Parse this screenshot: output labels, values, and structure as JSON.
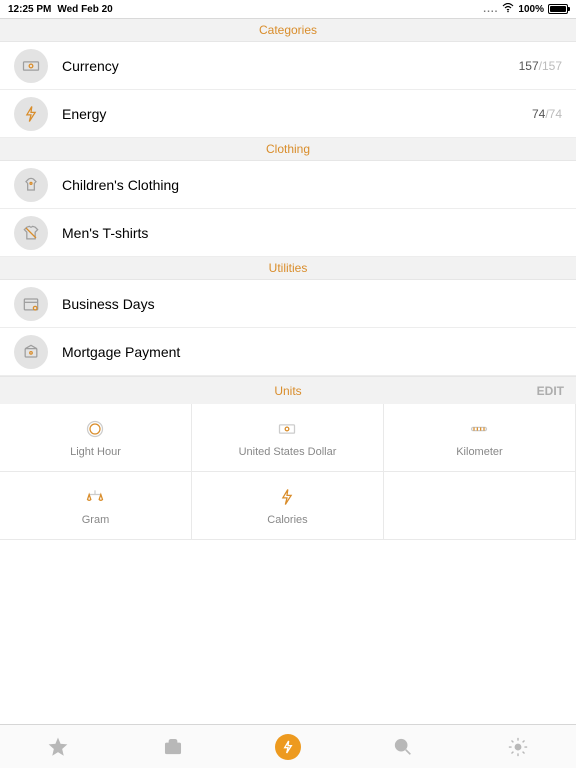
{
  "status": {
    "time": "12:25 PM",
    "date": "Wed Feb 20",
    "battery": "100%"
  },
  "sections": [
    {
      "title": "Categories",
      "rows": [
        {
          "label": "Currency",
          "count": {
            "have": "157",
            "of": "/157"
          },
          "icon": "currency-icon"
        },
        {
          "label": "Energy",
          "count": {
            "have": "74",
            "of": "/74"
          },
          "icon": "energy-icon"
        }
      ]
    },
    {
      "title": "Clothing",
      "rows": [
        {
          "label": "Children's Clothing",
          "icon": "children-clothing-icon"
        },
        {
          "label": "Men's T-shirts",
          "icon": "mens-tshirt-icon"
        }
      ]
    },
    {
      "title": "Utilities",
      "rows": [
        {
          "label": "Business Days",
          "icon": "business-days-icon"
        },
        {
          "label": "Mortgage Payment",
          "icon": "mortgage-icon"
        }
      ]
    }
  ],
  "units": {
    "title": "Units",
    "edit": "EDIT",
    "cells": [
      {
        "label": "Light Hour",
        "icon": "light-hour-icon"
      },
      {
        "label": "United States Dollar",
        "icon": "dollar-icon"
      },
      {
        "label": "Kilometer",
        "icon": "kilometer-icon"
      },
      {
        "label": "Gram",
        "icon": "gram-icon"
      },
      {
        "label": "Calories",
        "icon": "calories-icon"
      }
    ]
  }
}
